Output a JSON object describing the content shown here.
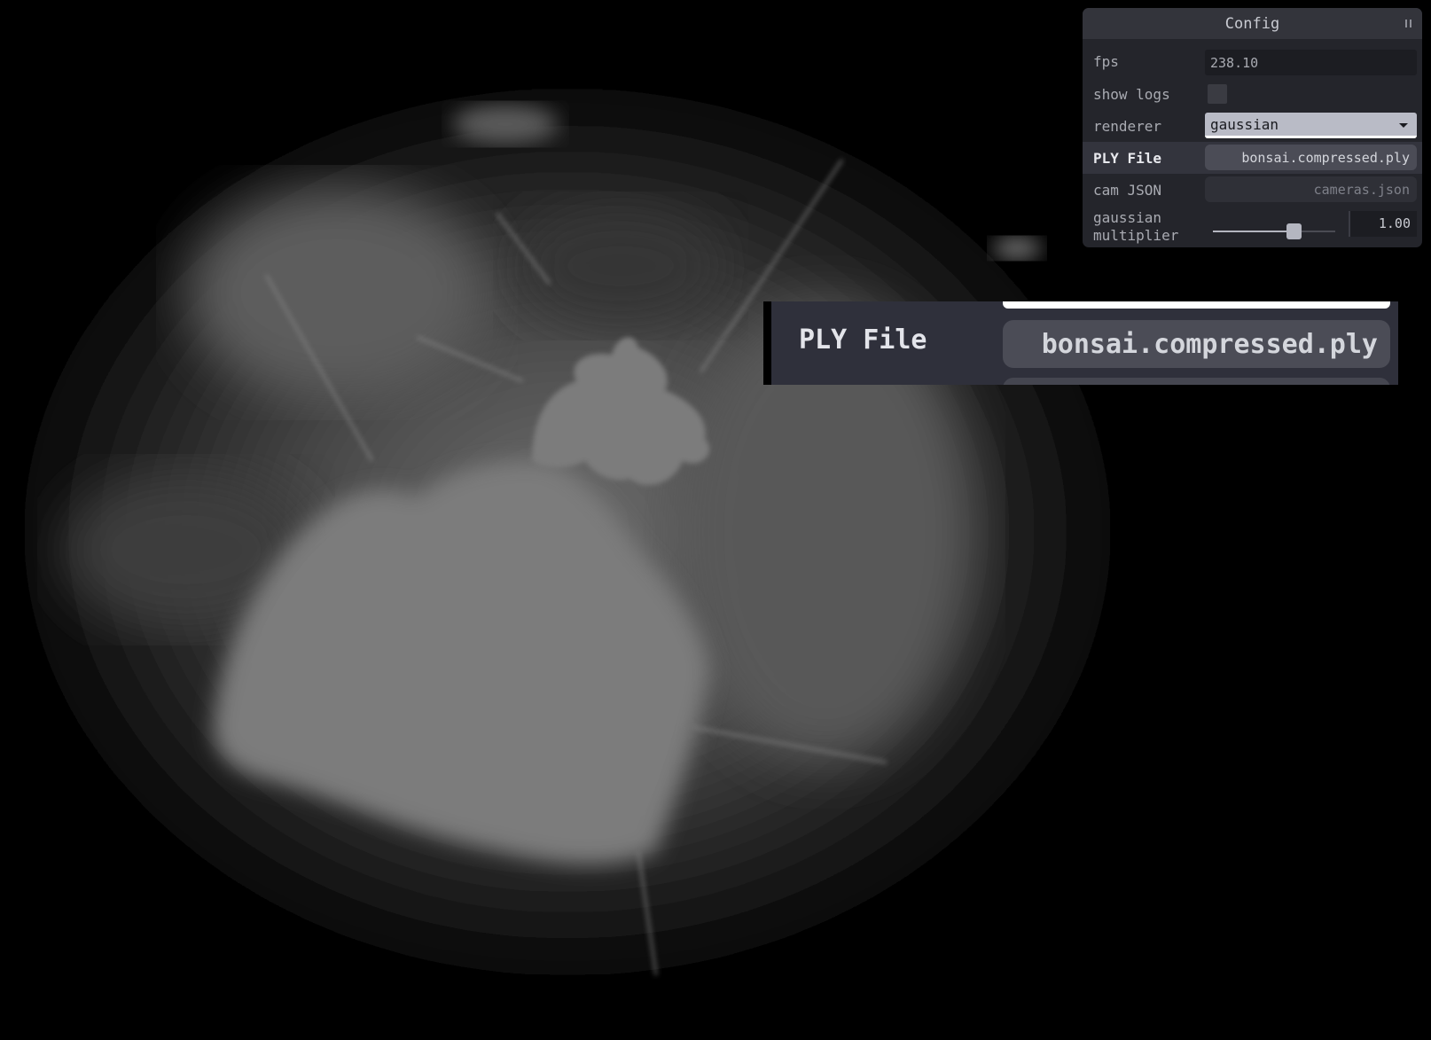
{
  "panel": {
    "title": "Config",
    "rows": {
      "fps": {
        "label": "fps",
        "value": "238.10"
      },
      "show_logs": {
        "label": "show logs",
        "checked": false
      },
      "renderer": {
        "label": "renderer",
        "value": "gaussian"
      },
      "ply_file": {
        "label": "PLY File",
        "value": "bonsai.compressed.ply"
      },
      "cam_json": {
        "label": "cam JSON",
        "value": "cameras.json"
      },
      "gaussian_multiplier": {
        "label_line1": "gaussian",
        "label_line2": "multiplier",
        "value": "1.00",
        "fraction": 0.66
      }
    }
  },
  "zoom": {
    "label": "PLY File",
    "value": "bonsai.compressed.ply"
  },
  "colors": {
    "panel_bg": "#24252b",
    "title_bg": "#33343b",
    "select_bg": "#b9bbc6",
    "button_bg": "#4b4c56"
  },
  "icons": {
    "panel_toggle": "pause-icon",
    "select_caret": "chevron-down-icon"
  }
}
